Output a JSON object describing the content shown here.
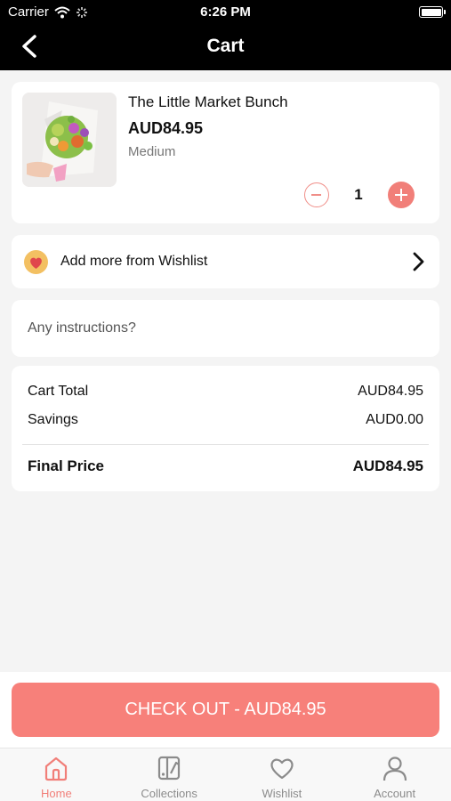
{
  "status_bar": {
    "carrier": "Carrier",
    "time": "6:26 PM"
  },
  "nav": {
    "title": "Cart",
    "back_icon": "chevron-left-icon"
  },
  "cart_item": {
    "name": "The Little Market Bunch",
    "price": "AUD84.95",
    "variant": "Medium",
    "quantity": "1"
  },
  "wishlist_row": {
    "label": "Add more from Wishlist",
    "icon": "heart-icon"
  },
  "instructions": {
    "placeholder": "Any instructions?"
  },
  "totals": {
    "cart_total_label": "Cart Total",
    "cart_total_value": "AUD84.95",
    "savings_label": "Savings",
    "savings_value": "AUD0.00",
    "final_label": "Final Price",
    "final_value": "AUD84.95"
  },
  "checkout": {
    "label": "CHECK OUT - AUD84.95"
  },
  "tabs": [
    {
      "label": "Home",
      "icon": "home-icon",
      "active": true
    },
    {
      "label": "Collections",
      "icon": "collections-icon",
      "active": false
    },
    {
      "label": "Wishlist",
      "icon": "heart-icon",
      "active": false
    },
    {
      "label": "Account",
      "icon": "user-icon",
      "active": false
    }
  ],
  "colors": {
    "accent": "#f17f79",
    "checkout_bg": "#f7807a",
    "wishlist_icon_bg": "#f3c062",
    "header_bg": "#000000"
  }
}
